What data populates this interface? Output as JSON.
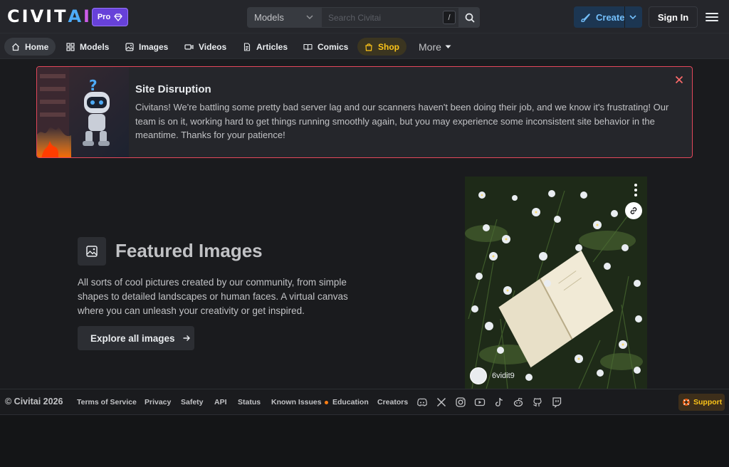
{
  "header": {
    "logo_text": "CIVITAI",
    "logo_colors": [
      "#ffffff",
      "#ffffff",
      "#ffffff",
      "#ffffff",
      "#ffffff",
      "#4dabf7",
      "#cc5de8"
    ],
    "pro_label": "Pro",
    "search_select": "Models",
    "search_placeholder": "Search Civitai",
    "search_shortcut": "/",
    "create_label": "Create",
    "signin_label": "Sign In"
  },
  "nav": {
    "items": [
      {
        "label": "Home",
        "icon": "home-icon"
      },
      {
        "label": "Models",
        "icon": "grid-icon"
      },
      {
        "label": "Images",
        "icon": "image-icon"
      },
      {
        "label": "Videos",
        "icon": "video-icon"
      },
      {
        "label": "Articles",
        "icon": "file-text-icon"
      },
      {
        "label": "Comics",
        "icon": "book-icon"
      },
      {
        "label": "Shop",
        "icon": "shopping-bag-icon"
      }
    ],
    "more_label": "More"
  },
  "alert": {
    "title": "Site Disruption",
    "body": "Civitans! We're battling some pretty bad server lag and our scanners haven't been doing their job, and we know it's frustrating! Our team is on it, working hard to get things running smoothly again, but you may experience some inconsistent site behavior in the meantime. Thanks for your patience!"
  },
  "featured": {
    "title": "Featured Images",
    "description": "All sorts of cool pictures created by our community, from simple shapes to detailed landscapes or human faces. A virtual canvas where you can unleash your creativity or get inspired.",
    "button_label": "Explore all images",
    "card_username": "6vidit9"
  },
  "footer": {
    "copyright": "© Civitai 2026",
    "links": [
      "Terms of Service",
      "Privacy",
      "Safety",
      "API",
      "Status",
      "Known Issues",
      "Education",
      "Creators"
    ],
    "support_label": "Support",
    "social_icons": [
      "discord-icon",
      "x-icon",
      "instagram-icon",
      "youtube-icon",
      "tiktok-icon",
      "reddit-icon",
      "github-icon",
      "twitch-icon"
    ]
  },
  "colors": {
    "accent_blue": "#74c0fc",
    "alert_border": "#e3475a",
    "shop_yellow": "#fcc419",
    "pro_purple": "#6741d9"
  }
}
